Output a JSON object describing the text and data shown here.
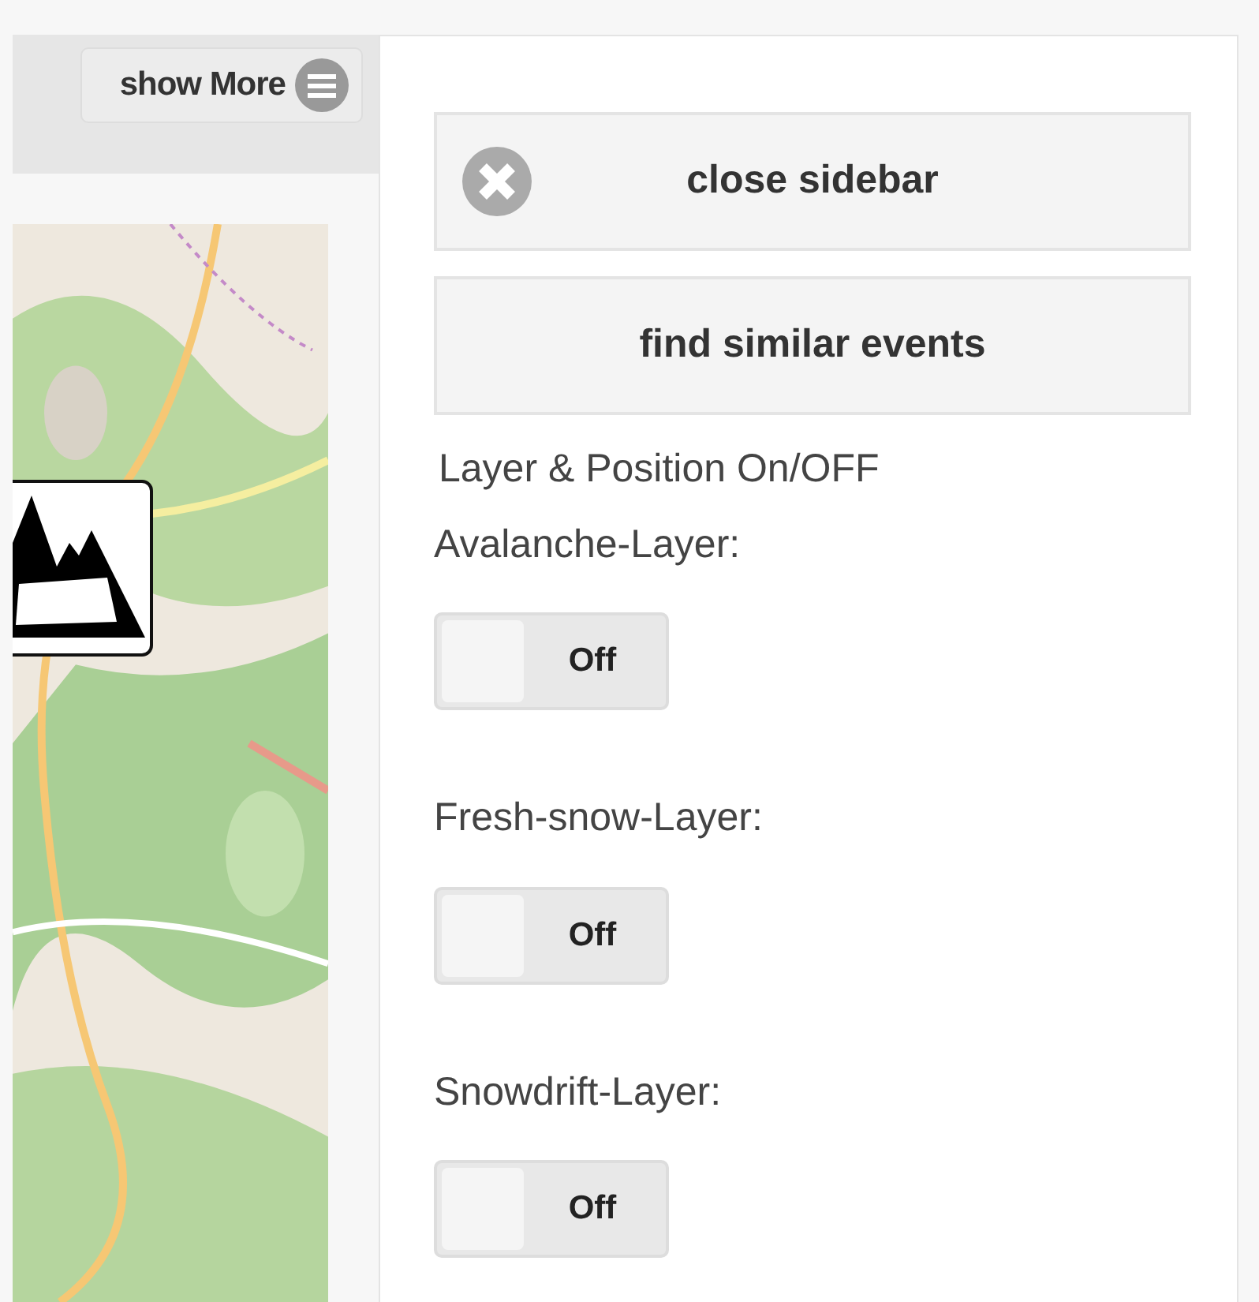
{
  "header": {
    "show_more": {
      "label": "show More"
    }
  },
  "map": {
    "kind": "picture",
    "marker": true
  },
  "sidebar": {
    "buttons": [
      {
        "kind": "close",
        "label": "close sidebar"
      },
      {
        "kind": "plain",
        "label": "find similar events"
      }
    ],
    "section_title": "Layer & Position On/OFF",
    "layers": [
      {
        "label": "Avalanche-Layer:",
        "toggle": "Off",
        "on": false
      },
      {
        "label": "Fresh-snow-Layer:",
        "toggle": "Off",
        "on": false
      },
      {
        "label": "Snowdrift-Layer:",
        "toggle": "Off",
        "on": false
      }
    ]
  }
}
